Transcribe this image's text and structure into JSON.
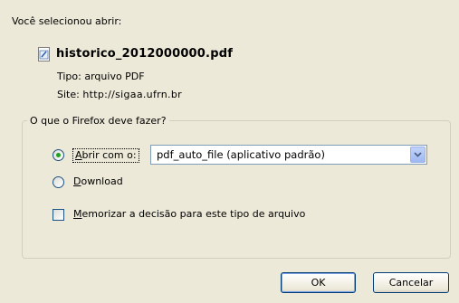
{
  "dialog": {
    "intro": "Você selecionou abrir:",
    "filename": "historico_2012000000.pdf",
    "type_label": "Tipo:",
    "type_value": "arquivo PDF",
    "site_label": "Site:",
    "site_value": "http://sigaa.ufrn.br",
    "group_title": "O que o Firefox deve fazer?",
    "open_with": {
      "accel": "A",
      "rest": "brir com o:",
      "selected": true
    },
    "app_select": "pdf_auto_file (aplicativo padrão)",
    "download": {
      "accel": "D",
      "rest": "ownload",
      "selected": false
    },
    "remember": {
      "accel": "M",
      "rest": "emorizar a decisão para este tipo de arquivo",
      "checked": false
    },
    "buttons": {
      "ok": "OK",
      "cancel": "Cancelar"
    }
  }
}
